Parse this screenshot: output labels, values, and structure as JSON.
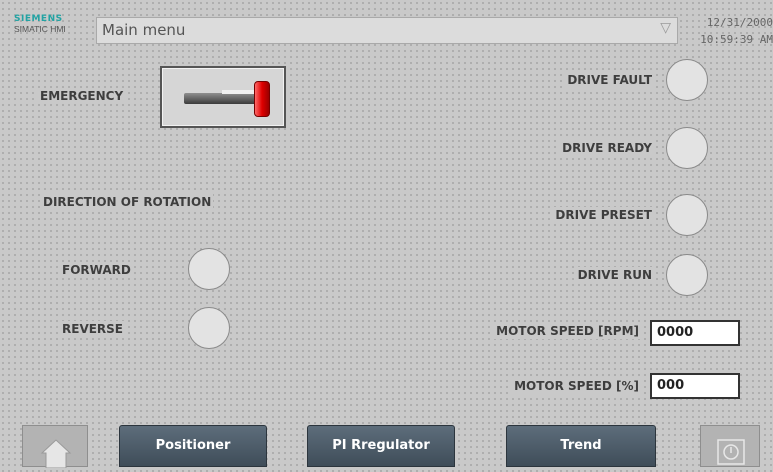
{
  "header": {
    "brand": "SIEMENS",
    "product": "SIMATIC HMI",
    "screen_name": "Main menu",
    "date": "12/31/2000",
    "time": "10:59:39 AM"
  },
  "left": {
    "emergency_label": "EMERGENCY",
    "direction_label": "DIRECTION OF ROTATION",
    "forward_label": "FORWARD",
    "reverse_label": "REVERSE"
  },
  "right": {
    "drive_fault": "DRIVE FAULT",
    "drive_ready": "DRIVE READY",
    "drive_preset": "DRIVE PRESET",
    "drive_run": "DRIVE RUN",
    "motor_speed_rpm_label": "MOTOR SPEED [RPM]",
    "motor_speed_rpm_value": "0000",
    "motor_speed_pct_label": "MOTOR SPEED [%]",
    "motor_speed_pct_value": "000"
  },
  "nav": {
    "home_icon": "home-icon",
    "positioner": "Positioner",
    "pi_regulator": "PI Rregulator",
    "trend": "Trend",
    "info_icon": "power-info-icon"
  },
  "colors": {
    "background": "#c9c9c9",
    "button": "#4e5d6a",
    "brand": "#22a3a3",
    "emergency_knob": "#e00000"
  }
}
